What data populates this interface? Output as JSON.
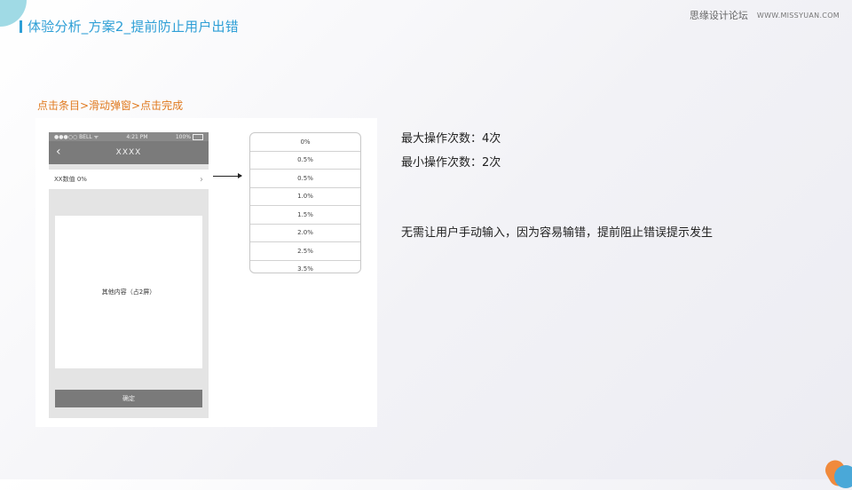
{
  "title": "体验分析_方案2_提前防止用户出错",
  "watermark": {
    "site_name": "思缘设计论坛",
    "site_url": "WWW.MISSYUAN.COM"
  },
  "flow_label": "点击条目>滑动弹窗>点击完成",
  "phone": {
    "status": {
      "carrier": "●●●○○ BELL ᯤ",
      "time": "4:21 PM",
      "battery": "100%"
    },
    "nav_title": "XXXX",
    "back_icon": "‹",
    "setting_row": {
      "label": "XX数值 0%",
      "chevron": "›"
    },
    "content_text": "其他内容（占2屏）",
    "confirm_label": "确定"
  },
  "picker": {
    "options": [
      "0%",
      "0.5%",
      "0.5%",
      "1.0%",
      "1.5%",
      "2.0%",
      "2.5%",
      "3.5%"
    ]
  },
  "info": {
    "max_ops": "最大操作次数：4次",
    "min_ops": "最小操作次数：2次",
    "note": "无需让用户手动输入，因为容易输错，提前阻止错误提示发生"
  },
  "colors": {
    "title": "#2e9fd6",
    "flow_label": "#e07a1f",
    "accent_orange": "#f08a3c",
    "accent_blue": "#4aa8d8"
  }
}
